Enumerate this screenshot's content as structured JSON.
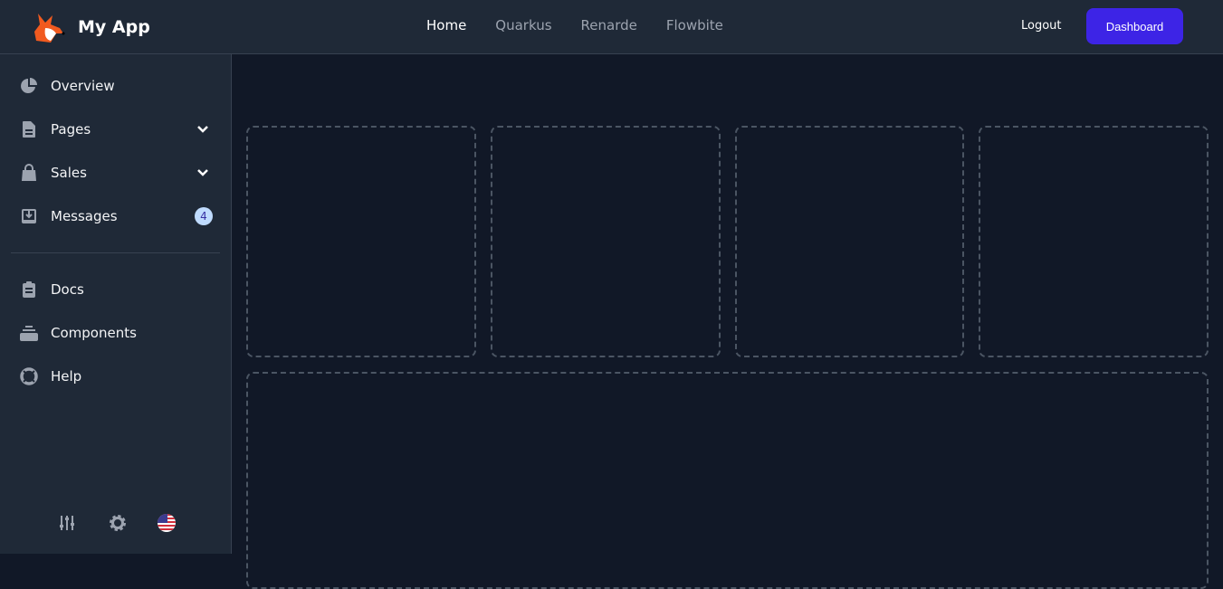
{
  "header": {
    "app_name": "My App",
    "nav": [
      {
        "label": "Home",
        "active": true
      },
      {
        "label": "Quarkus"
      },
      {
        "label": "Renarde"
      },
      {
        "label": "Flowbite"
      }
    ],
    "logout": "Logout",
    "dashboard": "Dashboard",
    "accent": "#3d24e6"
  },
  "sidebar": {
    "items": [
      {
        "label": "Overview",
        "icon": "chart-pie-icon"
      },
      {
        "label": "Pages",
        "icon": "document-icon",
        "dropdown": true
      },
      {
        "label": "Sales",
        "icon": "shopping-bag-icon",
        "dropdown": true
      },
      {
        "label": "Messages",
        "icon": "inbox-icon",
        "badge": "4"
      },
      {
        "label": "Docs",
        "icon": "clipboard-list-icon"
      },
      {
        "label": "Components",
        "icon": "collection-icon"
      },
      {
        "label": "Help",
        "icon": "support-icon"
      }
    ],
    "bottom": [
      "adjustments-icon",
      "gear-icon",
      "us-flag-icon"
    ]
  }
}
